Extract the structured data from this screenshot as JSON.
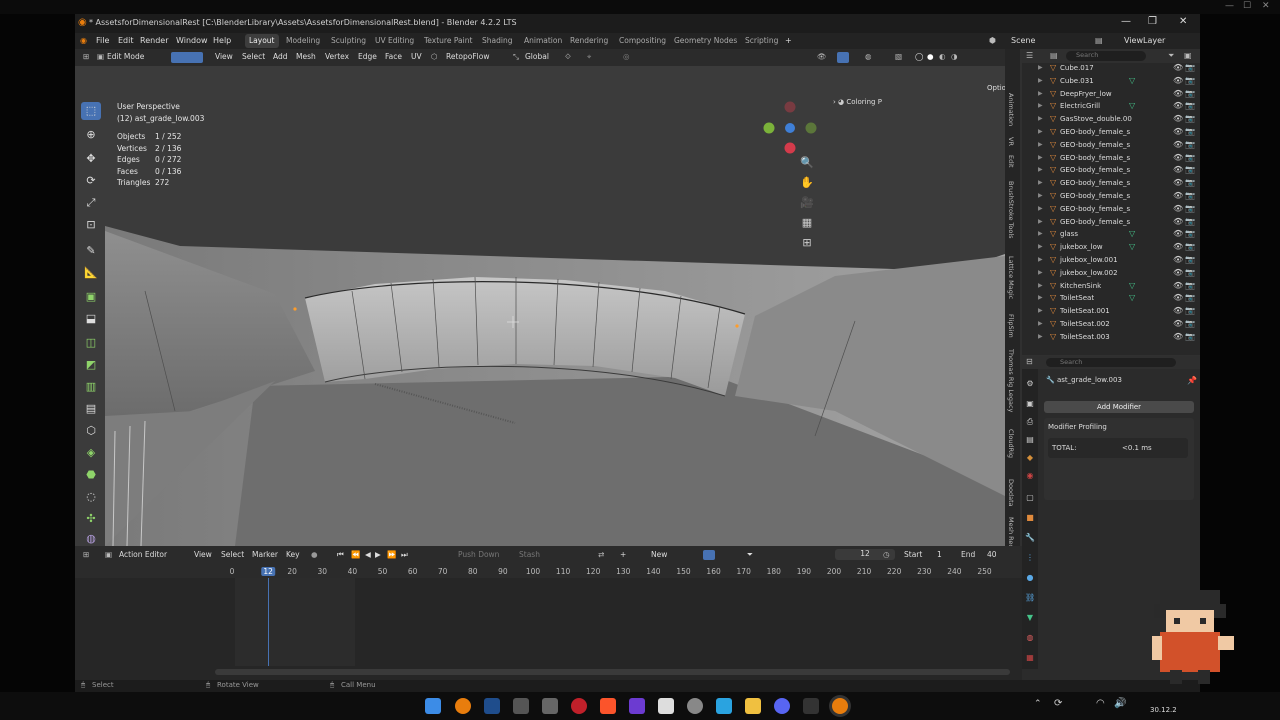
{
  "app": {
    "window_title": "* AssetsforDimensionalRest [C:\\BlenderLibrary\\Assets\\AssetsforDimensionalRest.blend] - Blender 4.2.2 LTS",
    "menus": [
      "File",
      "Edit",
      "Render",
      "Window",
      "Help"
    ],
    "workspaces": [
      "Layout",
      "Modeling",
      "Sculpting",
      "UV Editing",
      "Texture Paint",
      "Shading",
      "Animation",
      "Rendering",
      "Compositing",
      "Geometry Nodes",
      "Scripting"
    ],
    "active_workspace": "Layout",
    "add_workspace": "+",
    "scene_label": "Scene",
    "view_layer_label": "ViewLayer"
  },
  "viewport_header": {
    "mode": "Edit Mode",
    "menus": [
      "View",
      "Select",
      "Add",
      "Mesh",
      "Vertex",
      "Edge",
      "Face",
      "UV"
    ],
    "addon": "RetopoFlow",
    "orientation": "Global",
    "options": "Options",
    "coloring": "Coloring P"
  },
  "viewport_overlay": {
    "perspective": "User Perspective",
    "object": "(12) ast_grade_low.003",
    "stats": [
      {
        "label": "Objects",
        "value": "1 / 252"
      },
      {
        "label": "Vertices",
        "value": "2 / 136"
      },
      {
        "label": "Edges",
        "value": "0 / 272"
      },
      {
        "label": "Faces",
        "value": "0 / 136"
      },
      {
        "label": "Triangles",
        "value": "272"
      }
    ]
  },
  "sidebar_tabs": [
    "Animation",
    "VR",
    "Edit",
    "BrushStroke Tools",
    "Lattice Magic",
    "FlipSim",
    "Thomas Rig Legacy",
    "CloudRig",
    "Doodata",
    "Mesh Reco"
  ],
  "outliner": {
    "search_placeholder": "Search",
    "items": [
      "Cube.017",
      "Cube.031",
      "DeepFryer_low",
      "ElectricGrill",
      "GasStove_double.00",
      "GEO-body_female_s",
      "GEO-body_female_s",
      "GEO-body_female_s",
      "GEO-body_female_s",
      "GEO-body_female_s",
      "GEO-body_female_s",
      "GEO-body_female_s",
      "GEO-body_female_s",
      "glass",
      "jukebox_low",
      "jukebox_low.001",
      "jukebox_low.002",
      "KitchenSink",
      "ToiletSeat",
      "ToiletSeat.001",
      "ToiletSeat.002",
      "ToiletSeat.003"
    ]
  },
  "properties": {
    "search_placeholder": "Search",
    "object_name": "ast_grade_low.003",
    "add_modifier": "Add Modifier",
    "panel_title": "Modifier Profiling",
    "total_label": "TOTAL:",
    "total_value": "<0.1 ms"
  },
  "timeline": {
    "editor": "Action Editor",
    "menus": [
      "View",
      "Select",
      "Marker",
      "Key"
    ],
    "push_down": "Push Down",
    "stash": "Stash",
    "new_button": "New",
    "current_frame": "12",
    "start_label": "Start",
    "start_value": "1",
    "end_label": "End",
    "end_value": "40",
    "ruler_ticks": [
      "0",
      "12",
      "20",
      "30",
      "40",
      "50",
      "60",
      "70",
      "80",
      "90",
      "100",
      "110",
      "120",
      "130",
      "140",
      "150",
      "160",
      "170",
      "180",
      "190",
      "200",
      "210",
      "220",
      "230",
      "240",
      "250"
    ]
  },
  "statusbar": {
    "left": "Select",
    "mid": "Rotate View",
    "right": "Call Menu"
  },
  "taskbar": {
    "clock": "30.12.2"
  },
  "colors": {
    "accent_blue": "#4772b3",
    "object_orange": "#e08a3c",
    "vertex_green": "#45c48a"
  }
}
